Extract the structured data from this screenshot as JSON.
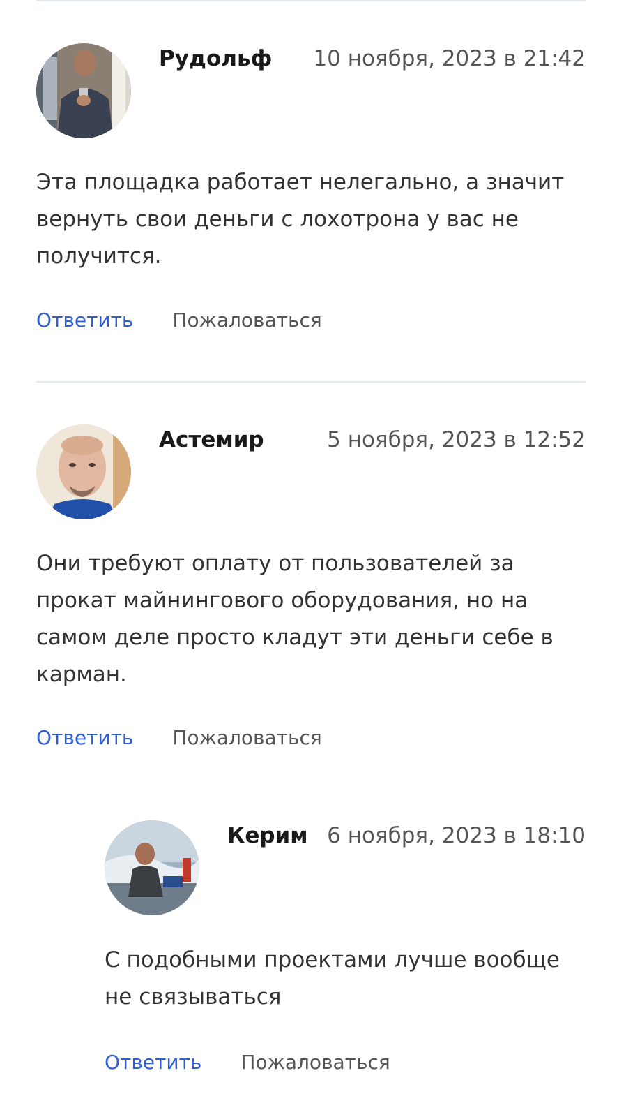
{
  "comments": [
    {
      "author": "Рудольф",
      "date": "10 ноября, 2023 в 21:42",
      "text": "Эта площадка работает нелегально, а значит вернуть свои деньги с лохотрона у вас не получится.",
      "reply_label": "Ответить",
      "report_label": "Пожаловаться"
    },
    {
      "author": "Астемир",
      "date": "5 ноября, 2023 в 12:52",
      "text": "Они требуют оплату от пользователей за прокат майнингового оборудования, но на самом деле просто кладут эти деньги себе в карман.",
      "reply_label": "Ответить",
      "report_label": "Пожаловаться"
    },
    {
      "author": "Керим",
      "date": "6 ноября, 2023 в 18:10",
      "text": "С подобными проектами лучше вообще не связываться",
      "reply_label": "Ответить",
      "report_label": "Пожаловаться"
    }
  ]
}
